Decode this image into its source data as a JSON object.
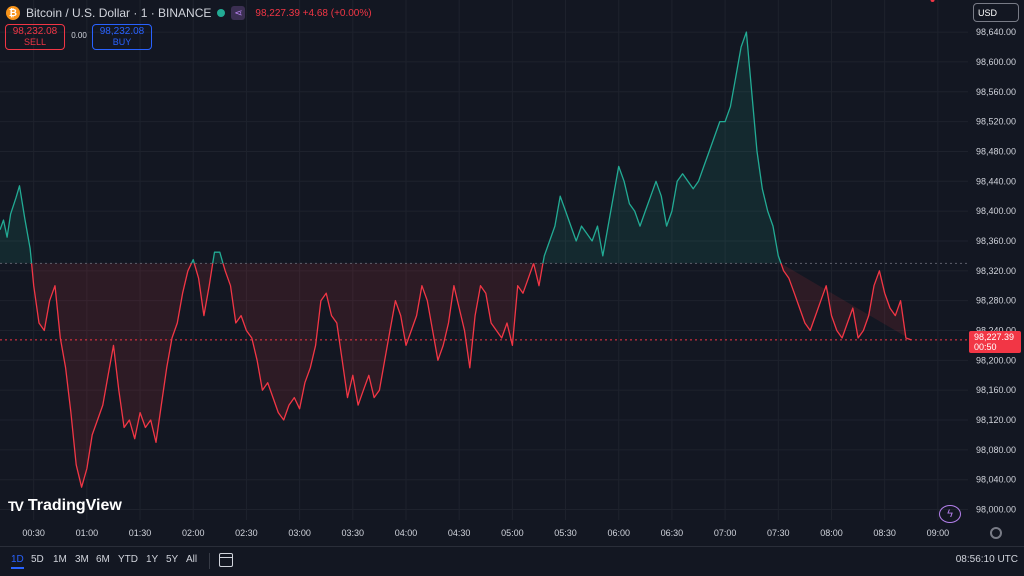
{
  "header": {
    "coin_glyph": "₿",
    "title": "Bitcoin / U.S. Dollar · 1 · BINANCE",
    "price_line": "98,227.39  +4.68 (+0.00%)",
    "status_icon": "green-dot-icon",
    "share_icon": "share-icon"
  },
  "trade": {
    "sell_price": "98,232.08",
    "sell_label": "SELL",
    "spread": "0.00",
    "buy_price": "98,232.08",
    "buy_label": "BUY"
  },
  "currency": "USD",
  "last_price": {
    "price": "98,227.39",
    "countdown": "00:50"
  },
  "logo_text": "TradingView",
  "bottom_bar": {
    "ranges": [
      "1D",
      "5D",
      "1M",
      "3M",
      "6M",
      "YTD",
      "1Y",
      "5Y",
      "All"
    ],
    "active_range": "1D",
    "time": "08:56:10 UTC"
  },
  "colors": {
    "background": "#131722",
    "up": "#22ab94",
    "down": "#f23645",
    "grid": "#1e222d",
    "accent": "#2962ff"
  },
  "chart_data": {
    "type": "area",
    "baseline": 98330,
    "baseline_style": "dotted",
    "last_price_line": 98227.39,
    "ylim": [
      97986,
      98683
    ],
    "xlim": [
      "00:11",
      "09:17"
    ],
    "y_ticks": [
      "98,000.00",
      "98,040.00",
      "98,080.00",
      "98,120.00",
      "98,160.00",
      "98,200.00",
      "98,240.00",
      "98,280.00",
      "98,320.00",
      "98,360.00",
      "98,400.00",
      "98,440.00",
      "98,480.00",
      "98,520.00",
      "98,560.00",
      "98,600.00",
      "98,640.00"
    ],
    "x_ticks": [
      "00:30",
      "01:00",
      "01:30",
      "02:00",
      "02:30",
      "03:00",
      "03:30",
      "04:00",
      "04:30",
      "05:00",
      "05:30",
      "06:00",
      "06:30",
      "07:00",
      "07:30",
      "08:00",
      "08:30",
      "09:00"
    ],
    "x": [
      "00:11",
      "00:13",
      "00:15",
      "00:17",
      "00:20",
      "00:22",
      "00:25",
      "00:28",
      "00:30",
      "00:33",
      "00:36",
      "00:39",
      "00:42",
      "00:45",
      "00:48",
      "00:51",
      "00:54",
      "00:57",
      "01:00",
      "01:03",
      "01:06",
      "01:09",
      "01:12",
      "01:15",
      "01:18",
      "01:21",
      "01:24",
      "01:27",
      "01:30",
      "01:33",
      "01:36",
      "01:39",
      "01:42",
      "01:45",
      "01:48",
      "01:51",
      "01:54",
      "01:57",
      "02:00",
      "02:03",
      "02:06",
      "02:09",
      "02:12",
      "02:15",
      "02:18",
      "02:21",
      "02:24",
      "02:27",
      "02:30",
      "02:33",
      "02:36",
      "02:39",
      "02:42",
      "02:45",
      "02:48",
      "02:51",
      "02:54",
      "02:57",
      "03:00",
      "03:03",
      "03:06",
      "03:09",
      "03:12",
      "03:15",
      "03:18",
      "03:21",
      "03:24",
      "03:27",
      "03:30",
      "03:33",
      "03:36",
      "03:39",
      "03:42",
      "03:45",
      "03:48",
      "03:51",
      "03:54",
      "03:57",
      "04:00",
      "04:03",
      "04:06",
      "04:09",
      "04:12",
      "04:15",
      "04:18",
      "04:21",
      "04:24",
      "04:27",
      "04:30",
      "04:33",
      "04:36",
      "04:39",
      "04:42",
      "04:45",
      "04:48",
      "04:51",
      "04:54",
      "04:57",
      "05:00",
      "05:03",
      "05:06",
      "05:09",
      "05:12",
      "05:15",
      "05:18",
      "05:21",
      "05:24",
      "05:27",
      "05:30",
      "05:33",
      "05:36",
      "05:39",
      "05:42",
      "05:45",
      "05:48",
      "05:51",
      "05:54",
      "05:57",
      "06:00",
      "06:03",
      "06:06",
      "06:09",
      "06:12",
      "06:15",
      "06:18",
      "06:21",
      "06:24",
      "06:27",
      "06:30",
      "06:33",
      "06:36",
      "06:39",
      "06:42",
      "06:45",
      "06:48",
      "06:51",
      "06:54",
      "06:57",
      "07:00",
      "07:03",
      "07:06",
      "07:09",
      "07:12",
      "07:15",
      "07:18",
      "07:21",
      "07:24",
      "07:27",
      "07:30",
      "07:33",
      "07:36",
      "07:39",
      "07:42",
      "07:45",
      "07:48",
      "07:51",
      "07:54",
      "07:57",
      "08:00",
      "08:03",
      "08:06",
      "08:09",
      "08:12",
      "08:15",
      "08:18",
      "08:21",
      "08:24",
      "08:27",
      "08:30",
      "08:33",
      "08:36",
      "08:39",
      "08:42",
      "08:45",
      "08:48",
      "08:51",
      "08:54",
      "08:57"
    ],
    "y": [
      98375,
      98388,
      98365,
      98396,
      98418,
      98434,
      98390,
      98350,
      98300,
      98250,
      98240,
      98280,
      98300,
      98230,
      98190,
      98130,
      98060,
      98030,
      98055,
      98100,
      98120,
      98140,
      98180,
      98220,
      98160,
      98110,
      98120,
      98095,
      98130,
      98110,
      98120,
      98090,
      98140,
      98190,
      98230,
      98250,
      98290,
      98320,
      98335,
      98310,
      98260,
      98300,
      98345,
      98345,
      98320,
      98300,
      98250,
      98260,
      98240,
      98230,
      98200,
      98160,
      98170,
      98150,
      98130,
      98120,
      98140,
      98150,
      98135,
      98170,
      98190,
      98220,
      98280,
      98290,
      98260,
      98250,
      98200,
      98150,
      98180,
      98140,
      98160,
      98180,
      98150,
      98160,
      98200,
      98240,
      98280,
      98260,
      98220,
      98240,
      98260,
      98300,
      98280,
      98240,
      98200,
      98220,
      98250,
      98300,
      98270,
      98240,
      98190,
      98260,
      98300,
      98290,
      98250,
      98240,
      98230,
      98250,
      98220,
      98300,
      98290,
      98310,
      98330,
      98300,
      98340,
      98360,
      98380,
      98420,
      98400,
      98380,
      98360,
      98380,
      98370,
      98360,
      98380,
      98340,
      98380,
      98420,
      98460,
      98440,
      98410,
      98400,
      98380,
      98400,
      98420,
      98440,
      98420,
      98380,
      98400,
      98440,
      98450,
      98440,
      98430,
      98440,
      98460,
      98480,
      98500,
      98520,
      98520,
      98540,
      98580,
      98620,
      98640,
      98560,
      98480,
      98430,
      98400,
      98380,
      98340,
      98320,
      98310,
      98290,
      98270,
      98250,
      98240,
      98260,
      98280,
      98300,
      98260,
      98240,
      98230,
      98250,
      98270,
      98230,
      98240,
      98260,
      98300,
      98320,
      98290,
      98270,
      98260,
      98280,
      98230,
      98227.39
    ]
  }
}
